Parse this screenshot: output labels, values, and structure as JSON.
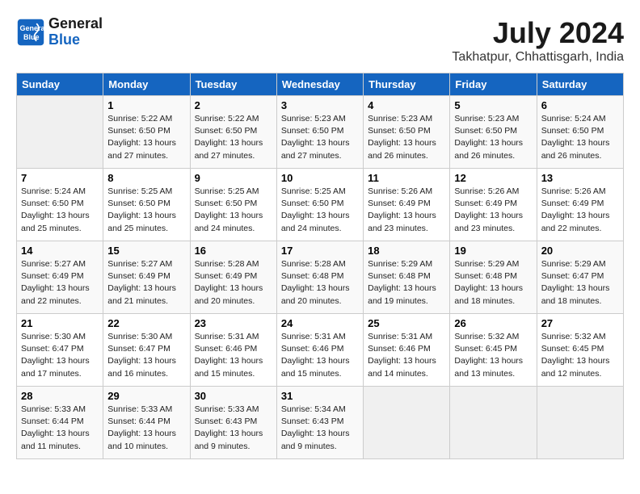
{
  "header": {
    "logo_line1": "General",
    "logo_line2": "Blue",
    "month": "July 2024",
    "location": "Takhatpur, Chhattisgarh, India"
  },
  "weekdays": [
    "Sunday",
    "Monday",
    "Tuesday",
    "Wednesday",
    "Thursday",
    "Friday",
    "Saturday"
  ],
  "weeks": [
    [
      {
        "day": "",
        "text": ""
      },
      {
        "day": "1",
        "text": "Sunrise: 5:22 AM\nSunset: 6:50 PM\nDaylight: 13 hours\nand 27 minutes."
      },
      {
        "day": "2",
        "text": "Sunrise: 5:22 AM\nSunset: 6:50 PM\nDaylight: 13 hours\nand 27 minutes."
      },
      {
        "day": "3",
        "text": "Sunrise: 5:23 AM\nSunset: 6:50 PM\nDaylight: 13 hours\nand 27 minutes."
      },
      {
        "day": "4",
        "text": "Sunrise: 5:23 AM\nSunset: 6:50 PM\nDaylight: 13 hours\nand 26 minutes."
      },
      {
        "day": "5",
        "text": "Sunrise: 5:23 AM\nSunset: 6:50 PM\nDaylight: 13 hours\nand 26 minutes."
      },
      {
        "day": "6",
        "text": "Sunrise: 5:24 AM\nSunset: 6:50 PM\nDaylight: 13 hours\nand 26 minutes."
      }
    ],
    [
      {
        "day": "7",
        "text": "Sunrise: 5:24 AM\nSunset: 6:50 PM\nDaylight: 13 hours\nand 25 minutes."
      },
      {
        "day": "8",
        "text": "Sunrise: 5:25 AM\nSunset: 6:50 PM\nDaylight: 13 hours\nand 25 minutes."
      },
      {
        "day": "9",
        "text": "Sunrise: 5:25 AM\nSunset: 6:50 PM\nDaylight: 13 hours\nand 24 minutes."
      },
      {
        "day": "10",
        "text": "Sunrise: 5:25 AM\nSunset: 6:50 PM\nDaylight: 13 hours\nand 24 minutes."
      },
      {
        "day": "11",
        "text": "Sunrise: 5:26 AM\nSunset: 6:49 PM\nDaylight: 13 hours\nand 23 minutes."
      },
      {
        "day": "12",
        "text": "Sunrise: 5:26 AM\nSunset: 6:49 PM\nDaylight: 13 hours\nand 23 minutes."
      },
      {
        "day": "13",
        "text": "Sunrise: 5:26 AM\nSunset: 6:49 PM\nDaylight: 13 hours\nand 22 minutes."
      }
    ],
    [
      {
        "day": "14",
        "text": "Sunrise: 5:27 AM\nSunset: 6:49 PM\nDaylight: 13 hours\nand 22 minutes."
      },
      {
        "day": "15",
        "text": "Sunrise: 5:27 AM\nSunset: 6:49 PM\nDaylight: 13 hours\nand 21 minutes."
      },
      {
        "day": "16",
        "text": "Sunrise: 5:28 AM\nSunset: 6:49 PM\nDaylight: 13 hours\nand 20 minutes."
      },
      {
        "day": "17",
        "text": "Sunrise: 5:28 AM\nSunset: 6:48 PM\nDaylight: 13 hours\nand 20 minutes."
      },
      {
        "day": "18",
        "text": "Sunrise: 5:29 AM\nSunset: 6:48 PM\nDaylight: 13 hours\nand 19 minutes."
      },
      {
        "day": "19",
        "text": "Sunrise: 5:29 AM\nSunset: 6:48 PM\nDaylight: 13 hours\nand 18 minutes."
      },
      {
        "day": "20",
        "text": "Sunrise: 5:29 AM\nSunset: 6:47 PM\nDaylight: 13 hours\nand 18 minutes."
      }
    ],
    [
      {
        "day": "21",
        "text": "Sunrise: 5:30 AM\nSunset: 6:47 PM\nDaylight: 13 hours\nand 17 minutes."
      },
      {
        "day": "22",
        "text": "Sunrise: 5:30 AM\nSunset: 6:47 PM\nDaylight: 13 hours\nand 16 minutes."
      },
      {
        "day": "23",
        "text": "Sunrise: 5:31 AM\nSunset: 6:46 PM\nDaylight: 13 hours\nand 15 minutes."
      },
      {
        "day": "24",
        "text": "Sunrise: 5:31 AM\nSunset: 6:46 PM\nDaylight: 13 hours\nand 15 minutes."
      },
      {
        "day": "25",
        "text": "Sunrise: 5:31 AM\nSunset: 6:46 PM\nDaylight: 13 hours\nand 14 minutes."
      },
      {
        "day": "26",
        "text": "Sunrise: 5:32 AM\nSunset: 6:45 PM\nDaylight: 13 hours\nand 13 minutes."
      },
      {
        "day": "27",
        "text": "Sunrise: 5:32 AM\nSunset: 6:45 PM\nDaylight: 13 hours\nand 12 minutes."
      }
    ],
    [
      {
        "day": "28",
        "text": "Sunrise: 5:33 AM\nSunset: 6:44 PM\nDaylight: 13 hours\nand 11 minutes."
      },
      {
        "day": "29",
        "text": "Sunrise: 5:33 AM\nSunset: 6:44 PM\nDaylight: 13 hours\nand 10 minutes."
      },
      {
        "day": "30",
        "text": "Sunrise: 5:33 AM\nSunset: 6:43 PM\nDaylight: 13 hours\nand 9 minutes."
      },
      {
        "day": "31",
        "text": "Sunrise: 5:34 AM\nSunset: 6:43 PM\nDaylight: 13 hours\nand 9 minutes."
      },
      {
        "day": "",
        "text": ""
      },
      {
        "day": "",
        "text": ""
      },
      {
        "day": "",
        "text": ""
      }
    ]
  ]
}
